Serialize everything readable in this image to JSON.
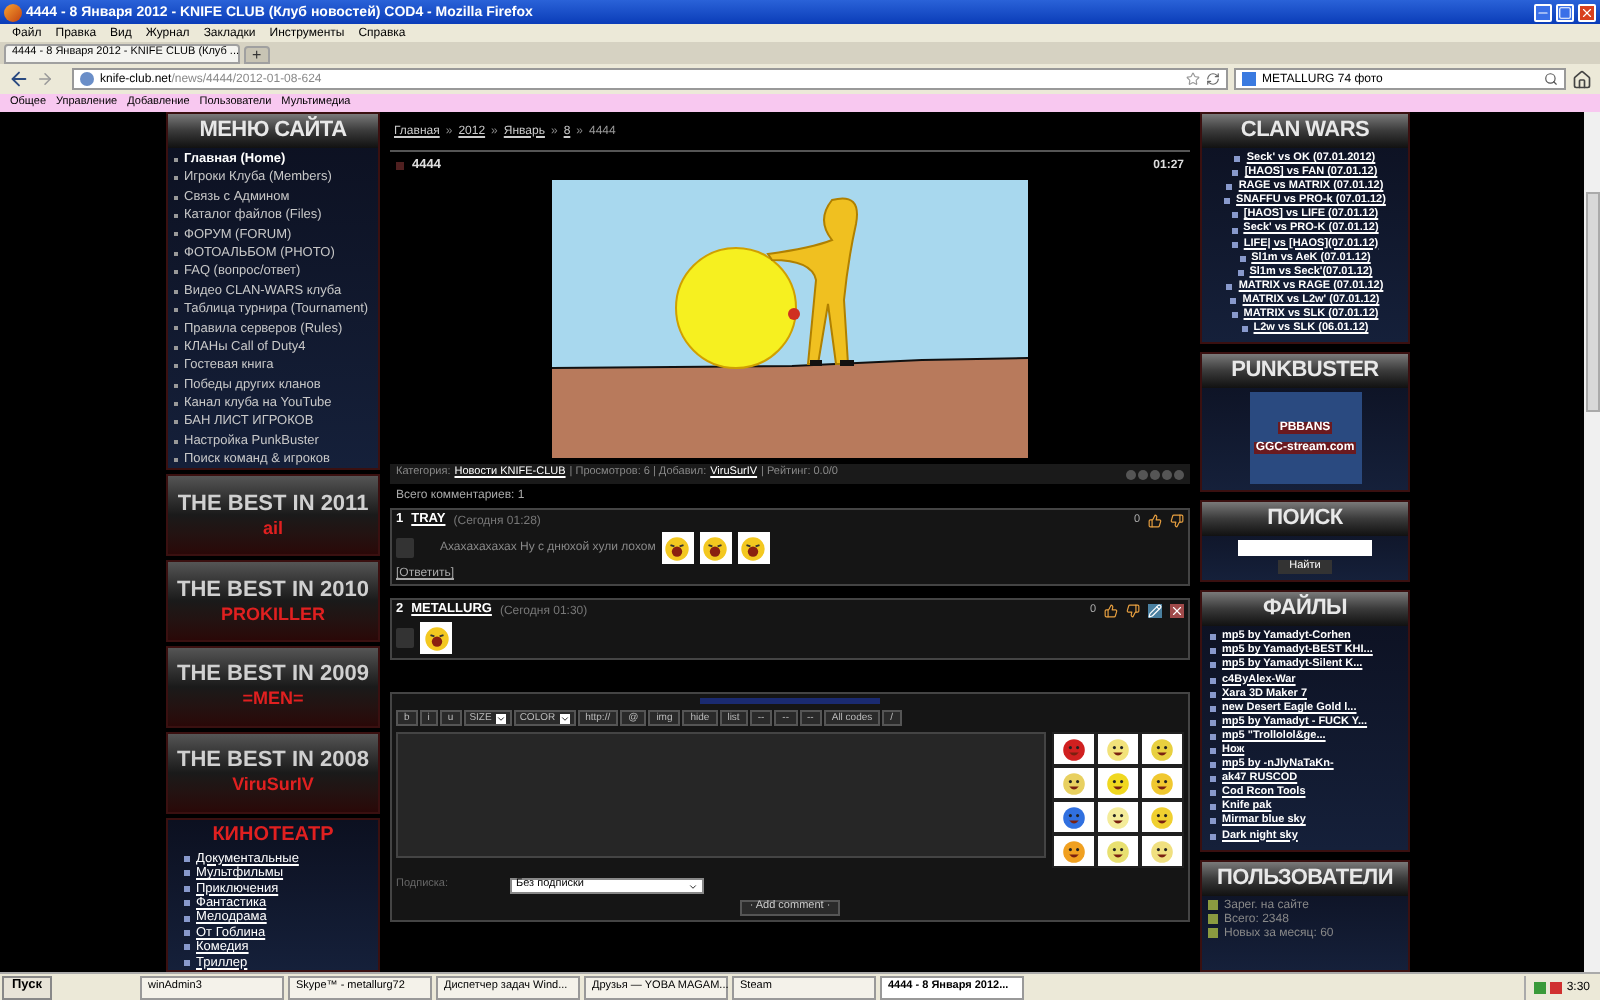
{
  "window": {
    "title": "4444 - 8 Января 2012 - KNIFE CLUB (Клуб новостей) COD4 - Mozilla Firefox"
  },
  "menu": [
    "Файл",
    "Правка",
    "Вид",
    "Журнал",
    "Закладки",
    "Инструменты",
    "Справка"
  ],
  "tabs": [
    {
      "label": "4444 - 8 Января 2012 - KNIFE CLUB (Клуб ...",
      "selected": true
    }
  ],
  "new_tab": "+",
  "address": {
    "host": "knife-club.net",
    "path": "/news/4444/2012-01-08-624"
  },
  "search": {
    "value": "METALLURG 74 фото"
  },
  "bookmarks": [
    "Общее",
    "Управление",
    "Добавление",
    "Пользователи",
    "Мультимедиа"
  ],
  "site_menu": {
    "title": "МЕНЮ САЙТА",
    "items": [
      {
        "label": "Главная (Home)",
        "selected": true
      },
      {
        "label": "Игроки Клуба (Members)",
        "selected": false
      },
      {
        "label": "Связь с Админом",
        "selected": false
      },
      {
        "label": "Каталог файлов (Files)",
        "selected": false
      },
      {
        "label": "ФОРУМ (FORUM)",
        "selected": false
      },
      {
        "label": "ФОТОАЛЬБОМ (PHOTO)",
        "selected": false
      },
      {
        "label": "FAQ (вопрос/ответ)",
        "selected": false
      },
      {
        "label": "Видео CLAN-WARS клуба",
        "selected": false
      },
      {
        "label": "Таблица турнира (Tournament)",
        "selected": false
      },
      {
        "label": "Правила серверов (Rules)",
        "selected": false
      },
      {
        "label": "КЛАНы Call of Duty4",
        "selected": false
      },
      {
        "label": "Гостевая книга",
        "selected": false
      },
      {
        "label": "Победы других кланов",
        "selected": false
      },
      {
        "label": "Канал клуба на YouTube",
        "selected": false
      },
      {
        "label": "БАН ЛИСТ ИГРОКОВ",
        "selected": false
      },
      {
        "label": "Настройка PunkBuster",
        "selected": false
      },
      {
        "label": "Поиск команд & игроков",
        "selected": false
      }
    ]
  },
  "best": [
    {
      "title": "THE BEST IN 2011",
      "winner": "ail"
    },
    {
      "title": "THE BEST IN 2010",
      "winner": "PROKILLER"
    },
    {
      "title": "THE BEST IN 2009",
      "winner": "=MEN="
    },
    {
      "title": "THE BEST IN 2008",
      "winner": "ViruSurIV"
    }
  ],
  "cinema": {
    "title": "КИНОТЕАТР",
    "items": [
      "Документальные",
      "Мультфильмы",
      "Приключения",
      "Фантастика",
      "Мелодрама",
      "От Гоблина",
      "Комедия",
      "Триллер"
    ]
  },
  "breadcrumb": [
    {
      "label": "Главная",
      "kind": "link"
    },
    {
      "label": "2012",
      "kind": "link"
    },
    {
      "label": "Январь",
      "kind": "link"
    },
    {
      "label": "8",
      "kind": "link"
    },
    {
      "label": "4444",
      "kind": "text"
    }
  ],
  "breadcrumb_separator": "»",
  "news": {
    "title": "4444",
    "time": "01:27",
    "meta": {
      "category_label": "Категория:",
      "category": "Новости KNIFE-CLUB",
      "views": "| Просмотров: 6 | Добавил:",
      "author": "ViruSurIV",
      "rating": "| Рейтинг: 0.0/0",
      "stars": 0
    }
  },
  "comments_total": "Всего комментариев: 1",
  "comments": [
    {
      "number": "1",
      "author": "TRAY",
      "time": "(Сегодня 01:28)",
      "text": "Ахахахахахах Ну с днюхой хули лохом",
      "attachments": [
        {
          "kind": "smiley"
        },
        {
          "kind": "smiley"
        },
        {
          "kind": "smiley"
        }
      ],
      "reply": "[Ответить]",
      "votes": "0",
      "editable": false
    },
    {
      "number": "2",
      "author": "METALLURG",
      "time": "(Сегодня 01:30)",
      "attachments": [
        {
          "kind": "smiley"
        }
      ],
      "votes": "0",
      "editable": true
    }
  ],
  "editor": {
    "toolbar": [
      {
        "label": "b",
        "kind": "button"
      },
      {
        "label": "i",
        "kind": "button"
      },
      {
        "label": "u",
        "kind": "button"
      },
      {
        "label": "SIZE",
        "kind": "select"
      },
      {
        "label": "COLOR",
        "kind": "select"
      },
      {
        "label": "http://",
        "kind": "button"
      },
      {
        "label": "@",
        "kind": "button"
      },
      {
        "label": "img",
        "kind": "button"
      },
      {
        "label": "hide",
        "kind": "button"
      },
      {
        "label": "list",
        "kind": "button"
      },
      {
        "label": "--",
        "kind": "button"
      },
      {
        "label": "--",
        "kind": "button"
      },
      {
        "label": "--",
        "kind": "button"
      },
      {
        "label": "All codes",
        "kind": "button"
      },
      {
        "label": "/",
        "kind": "button"
      }
    ],
    "smileys": [
      {
        "color": "#d02020"
      },
      {
        "color": "#f2e27a"
      },
      {
        "color": "#e8d040"
      },
      {
        "color": "#e8d060"
      },
      {
        "color": "#f0d820"
      },
      {
        "color": "#f0c830"
      },
      {
        "color": "#3070e0"
      },
      {
        "color": "#f4ec9a"
      },
      {
        "color": "#f0d030"
      },
      {
        "color": "#f0a020"
      },
      {
        "color": "#e8e070"
      },
      {
        "color": "#f0e080"
      }
    ],
    "subscribe": {
      "label": "Подписка:",
      "value": "Без подписки"
    },
    "submit": "· Add comment ·"
  },
  "clan_wars": {
    "title": "CLAN WARS",
    "items": [
      "Seck' vs OK (07.01.2012)",
      "[HAOS] vs FAN (07.01.12)",
      "RAGE vs MATRIX (07.01.12)",
      "SNAFFU vs PRO-k (07.01.12)",
      "[HAOS] vs LIFE (07.01.12)",
      "Seck' vs PRO-K (07.01.12)",
      "LIFE| vs [HAOS](07.01.12)",
      "Sl1m vs AeK (07.01.12)",
      "Sl1m vs Seck'(07.01.12)",
      "MATRIX vs RAGE (07.01.12)",
      "MATRIX vs L2w' (07.01.12)",
      "MATRIX vs SLK (07.01.12)",
      "L2w vs SLK (06.01.12)"
    ]
  },
  "punkbuster": {
    "title": "PUNKBUSTER",
    "ad": [
      "PBBANS",
      "GGC-stream.com"
    ]
  },
  "site_search": {
    "title": "ПОИСК",
    "button": "Найти"
  },
  "files": {
    "title": "ФАЙЛЫ",
    "items": [
      "mp5 by Yamadyt-Corhen",
      "mp5 by Yamadyt-BEST KHI...",
      "mp5 by Yamadyt-Silent K...",
      "c4ByAlex-War",
      "Xara 3D Maker 7",
      "new Desert Eagle Gold l...",
      "mp5 by Yamadyt - FUCK Y...",
      "mp5 \"Trollolol&ge...",
      "Нож",
      "mp5 by -nJlyNaTaKn-",
      "ak47 RUSCOD",
      "Cod Rcon Tools",
      "Knife pak",
      "Mirmar blue sky",
      "Dark night sky"
    ]
  },
  "users": {
    "title": "ПОЛЬЗОВАТЕЛИ",
    "items": [
      "Зарег. на сайте",
      "Всего: 2348",
      "Новых за месяц: 60"
    ]
  },
  "taskbar": {
    "start": "Пуск",
    "items": [
      {
        "label": "winAdmin3",
        "selected": false
      },
      {
        "label": "Skype™ - metallurg72",
        "selected": false
      },
      {
        "label": "Диспетчер задач Wind...",
        "selected": false
      },
      {
        "label": "Друзья — YOBA MAGAM...",
        "selected": false
      },
      {
        "label": "Steam",
        "selected": false
      },
      {
        "label": "4444 - 8 Января 2012...",
        "selected": true
      }
    ],
    "clock": "3:30"
  }
}
